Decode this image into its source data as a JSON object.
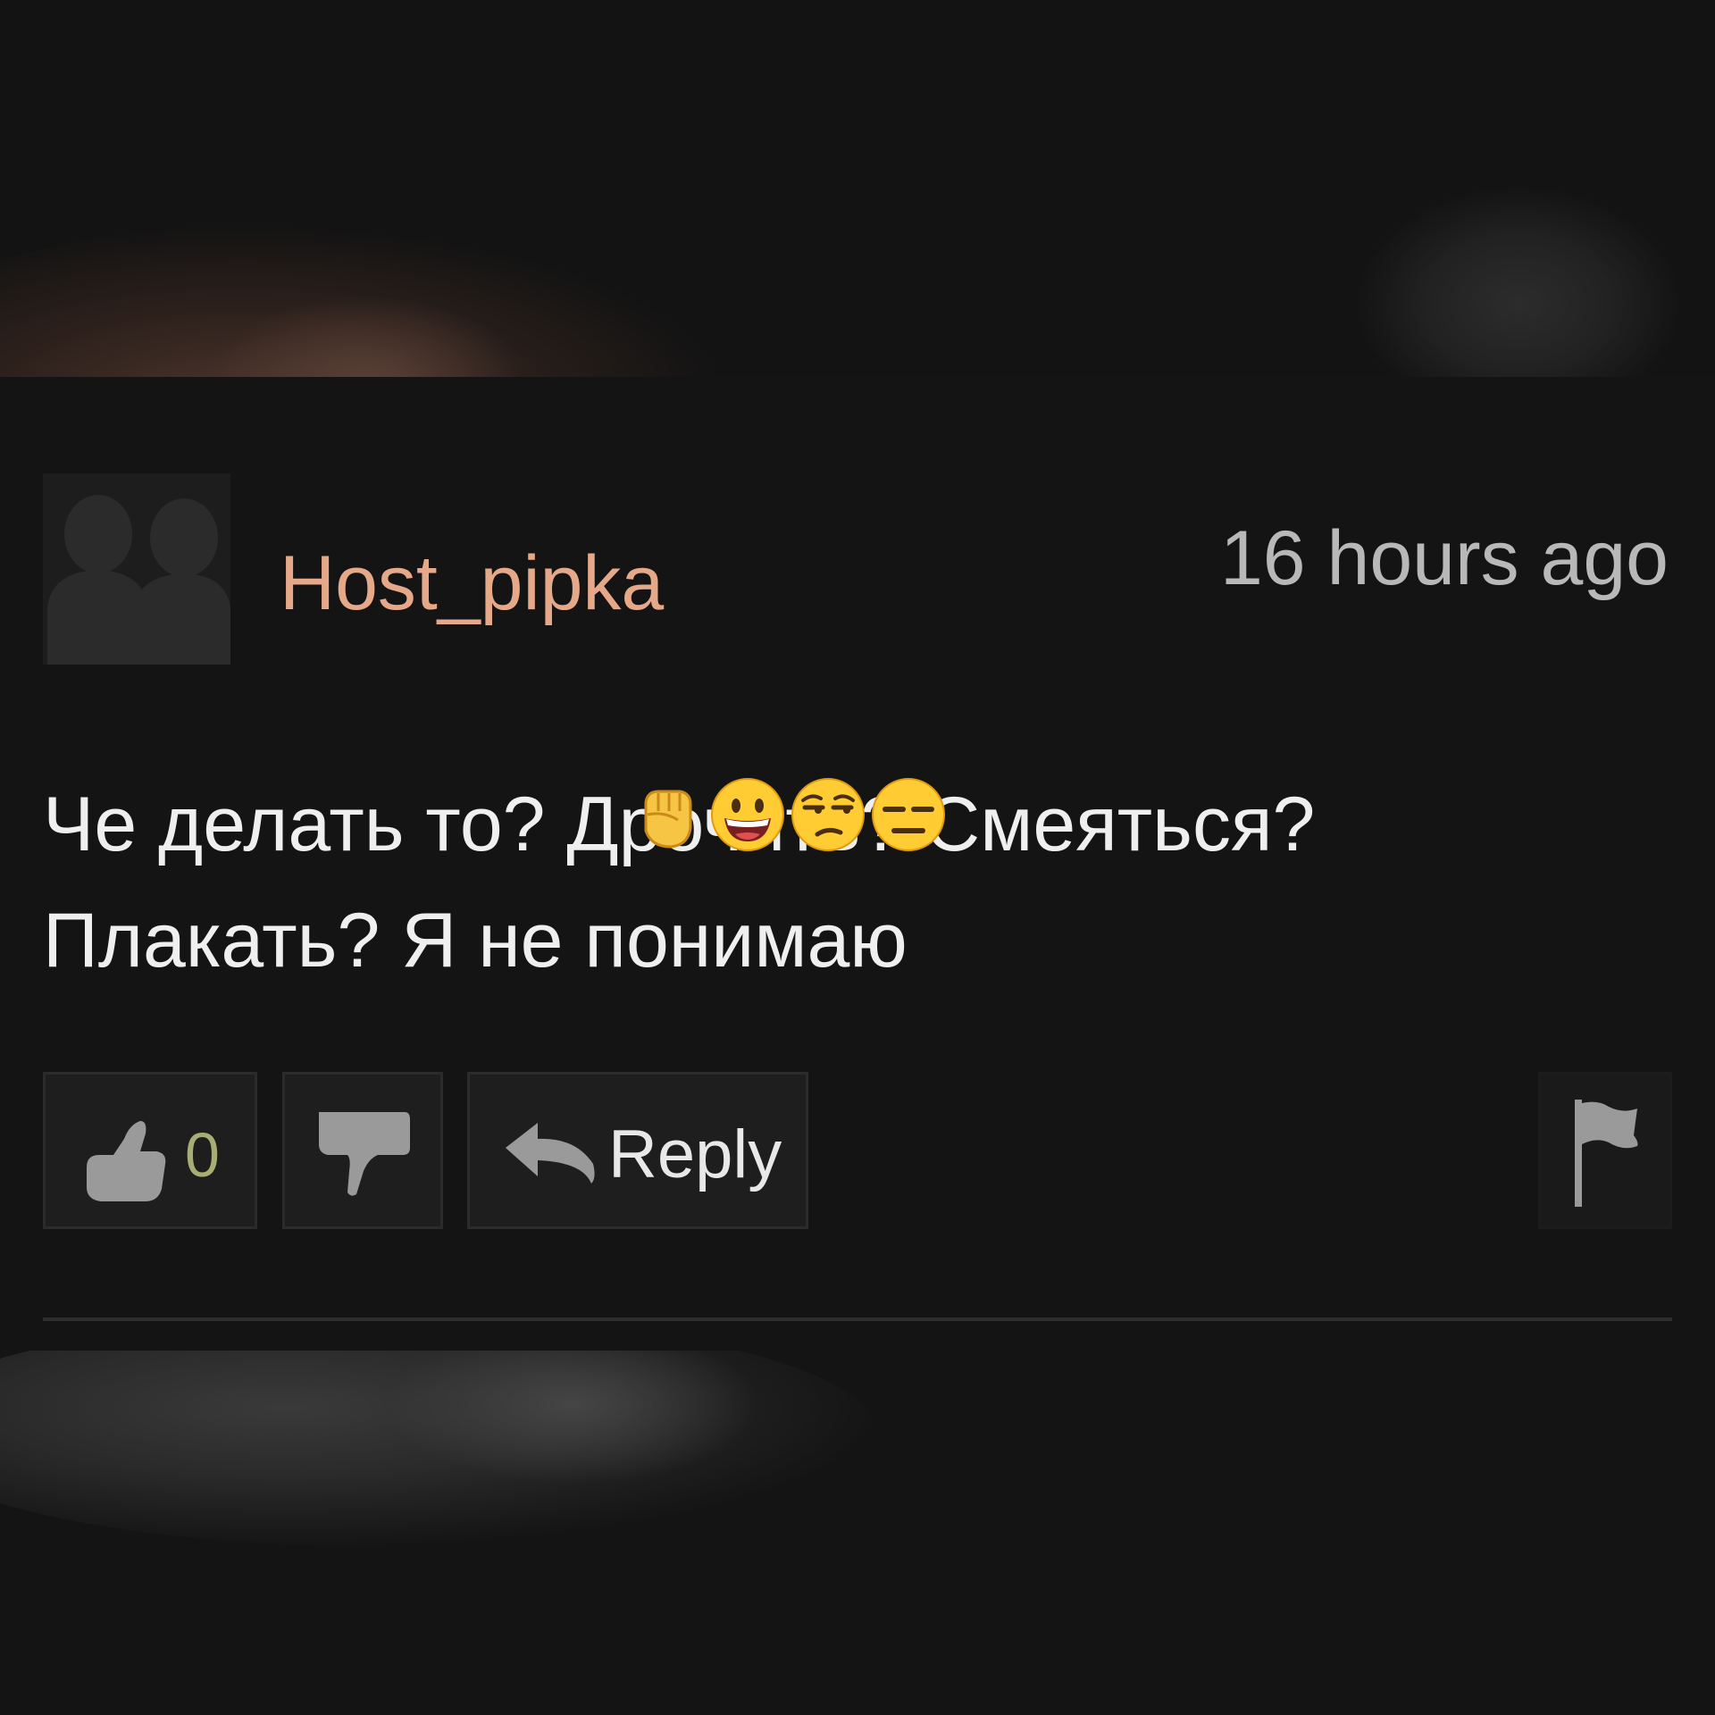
{
  "comment": {
    "username": "Host_pipka",
    "timestamp": "16 hours ago",
    "text_line1": "Че делать то? Дрочить? Смеяться?",
    "text_line2": "Плакать? Я не понимаю"
  },
  "actions": {
    "like_count": "0",
    "reply_label": "Reply"
  },
  "emojis": [
    "raised-fist-emoji",
    "grinning-face-emoji",
    "unamused-face-emoji",
    "expressionless-face-emoji"
  ],
  "colors": {
    "username": "#e5a888",
    "like_count": "#a8ad74",
    "background": "#121212"
  }
}
